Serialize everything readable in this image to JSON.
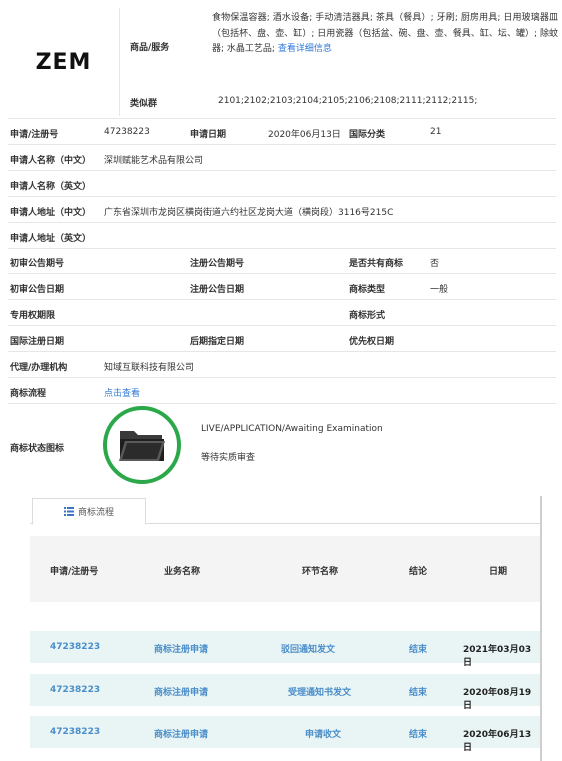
{
  "brand": {
    "logo_text": "ZEM"
  },
  "goods": {
    "label": "商品/服务",
    "text": "食物保温容器; 酒水设备; 手动清洁器具; 茶具（餐具）; 牙刷; 厨房用具; 日用玻璃器皿（包括杯、盘、壶、缸）; 日用瓷器（包括盆、碗、盘、壶、餐具、缸、坛、罐）; 除蚊器; 水晶工艺品;",
    "more_link": "查看详细信息"
  },
  "similar_groups": {
    "label": "类似群",
    "value": "2101;2102;2103;2104;2105;2106;2108;2111;2112;2115;"
  },
  "fields": {
    "reg_no_label": "申请/注册号",
    "reg_no": "47238223",
    "apply_date_label": "申请日期",
    "apply_date": "2020年06月13日",
    "intl_class_label": "国际分类",
    "intl_class": "21",
    "applicant_cn_label": "申请人名称（中文）",
    "applicant_cn": "深圳赋能艺术品有限公司",
    "applicant_en_label": "申请人名称（英文）",
    "applicant_en": "",
    "address_cn_label": "申请人地址（中文）",
    "address_cn": "广东省深圳市龙岗区横岗街道六约社区龙岗大道（横岗段）3116号215C",
    "address_en_label": "申请人地址（英文）",
    "address_en": "",
    "prelim_no_label": "初审公告期号",
    "prelim_no": "",
    "reg_notice_no_label": "注册公告期号",
    "reg_notice_no": "",
    "shared_label": "是否共有商标",
    "shared": "否",
    "prelim_date_label": "初审公告日期",
    "prelim_date": "",
    "reg_notice_date_label": "注册公告日期",
    "reg_notice_date": "",
    "tm_type_label": "商标类型",
    "tm_type": "一般",
    "exclusive_label": "专用权期限",
    "exclusive": "",
    "tm_form_label": "商标形式",
    "tm_form": "",
    "intl_reg_date_label": "国际注册日期",
    "intl_reg_date": "",
    "later_date_label": "后期指定日期",
    "later_date": "",
    "priority_label": "优先权日期",
    "priority": "",
    "agent_label": "代理/办理机构",
    "agent": "知域互联科技有限公司",
    "process_label": "商标流程",
    "process_link": "点击查看",
    "status_label": "商标状态图标",
    "status_en": "LIVE/APPLICATION/Awaiting Examination",
    "status_cn": "等待实质审查"
  },
  "flow": {
    "tab_label": "商标流程",
    "headers": [
      "申请/注册号",
      "业务名称",
      "环节名称",
      "结论",
      "日期"
    ],
    "rows": [
      {
        "reg_no": "47238223",
        "business": "商标注册申请",
        "step": "驳回通知发文",
        "result": "结束",
        "date": "2021年03月03日"
      },
      {
        "reg_no": "47238223",
        "business": "商标注册申请",
        "step": "受理通知书发文",
        "result": "结束",
        "date": "2020年08月19日"
      },
      {
        "reg_no": "47238223",
        "business": "商标注册申请",
        "step": "申请收文",
        "result": "结束",
        "date": "2020年06月13日"
      }
    ]
  },
  "colors": {
    "link": "#2f78d8",
    "status_ring": "#2aa84a",
    "flow_row_bg": "#e9f4f4",
    "flow_link": "#4a8ec9"
  },
  "icons": {
    "status": "folder-open-icon",
    "tab": "list-icon"
  }
}
